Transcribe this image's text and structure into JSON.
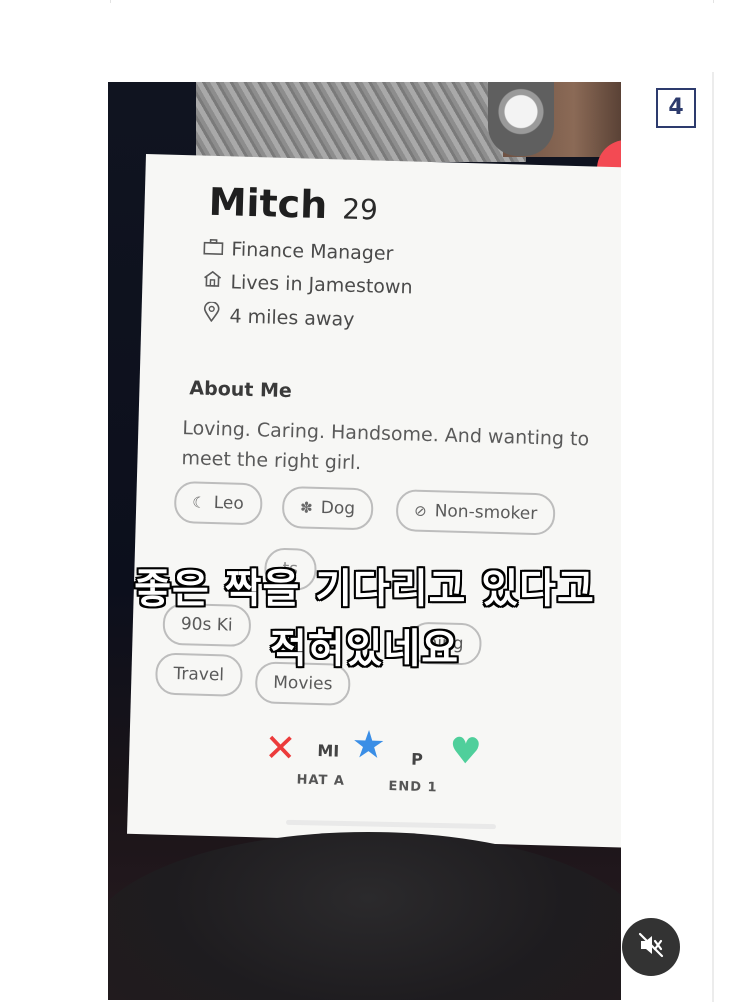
{
  "slide": {
    "number": "4"
  },
  "profile": {
    "name": "Mitch",
    "age": "29",
    "job": "Finance Manager",
    "lives": "Lives in Jamestown",
    "distance": "4 miles away",
    "about_title": "About Me",
    "about_text": "Loving. Caring. Handsome. And wanting to meet the right girl.",
    "chips": [
      "Leo",
      "Dog",
      "Non-smoker",
      "90s Ki",
      "ts",
      "ning",
      "Travel",
      "Movies"
    ]
  },
  "actions": {
    "text_top_left": "MI",
    "text_top_right": "P",
    "text_bottom_left": "HAT A",
    "text_bottom_right": "END 1"
  },
  "caption": {
    "line1": "좋은 짝을 기다리고 있다고",
    "line2": "적혀있네요"
  },
  "controls": {
    "mute_icon": "muted-speaker-icon"
  }
}
